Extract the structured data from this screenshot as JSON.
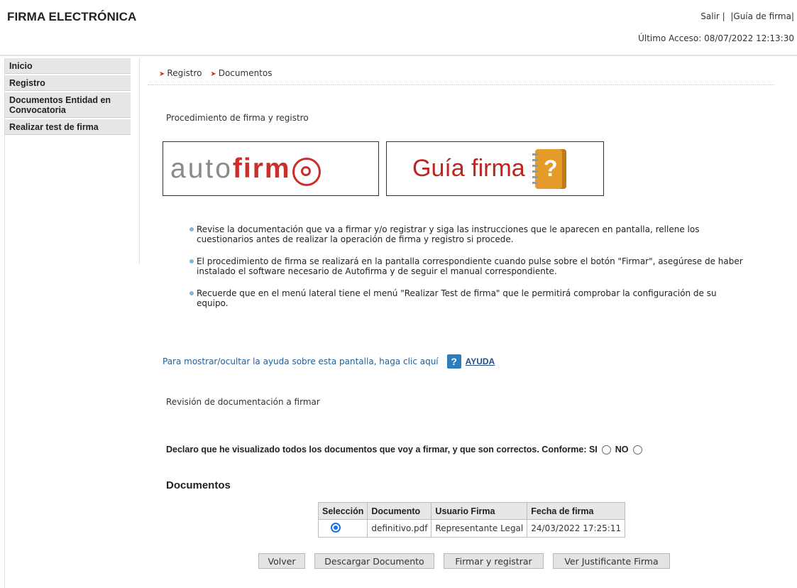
{
  "header": {
    "app_title": "FIRMA ELECTRÓNICA",
    "links": {
      "logout": "Salir",
      "guide": "Guía de firma",
      "sep": "|"
    },
    "last_access": "Último Acceso: 08/07/2022 12:13:30"
  },
  "sidebar": {
    "items": [
      {
        "label": "Inicio"
      },
      {
        "label": "Registro"
      },
      {
        "label": "Documentos Entidad en Convocatoria"
      },
      {
        "label": "Realizar test de firma"
      }
    ]
  },
  "breadcrumb": {
    "items": [
      "Registro",
      "Documentos"
    ]
  },
  "procedure": {
    "heading": "Procedimiento de firma y registro",
    "autofirma_logo": {
      "text_plain": "auto",
      "text_bold": "firm"
    },
    "guide_logo": {
      "text": "Guía firma",
      "icon": "book-help-icon",
      "icon_glyph": "?"
    }
  },
  "instructions": [
    "Revise la documentación que va a firmar y/o registrar y siga las instrucciones que le aparecen en pantalla, rellene los cuestionarios antes de realizar la operación de firma y registro si procede.",
    "El procedimiento de firma se realizará en la pantalla correspondiente cuando pulse sobre el botón \"Firmar\", asegúrese de haber instalado el software necesario de Autofirma y de seguir el manual correspondiente.",
    "Recuerde que en el menú lateral tiene el menú \"Realizar Test de firma\" que le permitirá comprobar la configuración de su equipo."
  ],
  "help": {
    "text": "Para mostrar/ocultar la ayuda sobre esta pantalla, haga clic aquí",
    "icon_glyph": "?",
    "link": "AYUDA"
  },
  "review_heading": "Revisión de documentación a firmar",
  "declaration": {
    "text": "Declaro que he visualizado todos los documentos que voy a firmar, y que son correctos. Conforme: SI",
    "no_label": "NO"
  },
  "documents": {
    "title": "Documentos",
    "columns": [
      "Selección",
      "Documento",
      "Usuario Firma",
      "Fecha de firma"
    ],
    "rows": [
      {
        "selected": true,
        "document": "definitivo.pdf",
        "user": "Representante Legal",
        "date": "24/03/2022 17:25:11"
      }
    ]
  },
  "buttons": {
    "back": "Volver",
    "download": "Descargar Documento",
    "sign": "Firmar y registrar",
    "receipt": "Ver Justificante Firma"
  },
  "colors": {
    "accent_red": "#c9302c",
    "link_blue": "#1f5e9a",
    "radio_blue": "#1a73e8"
  }
}
